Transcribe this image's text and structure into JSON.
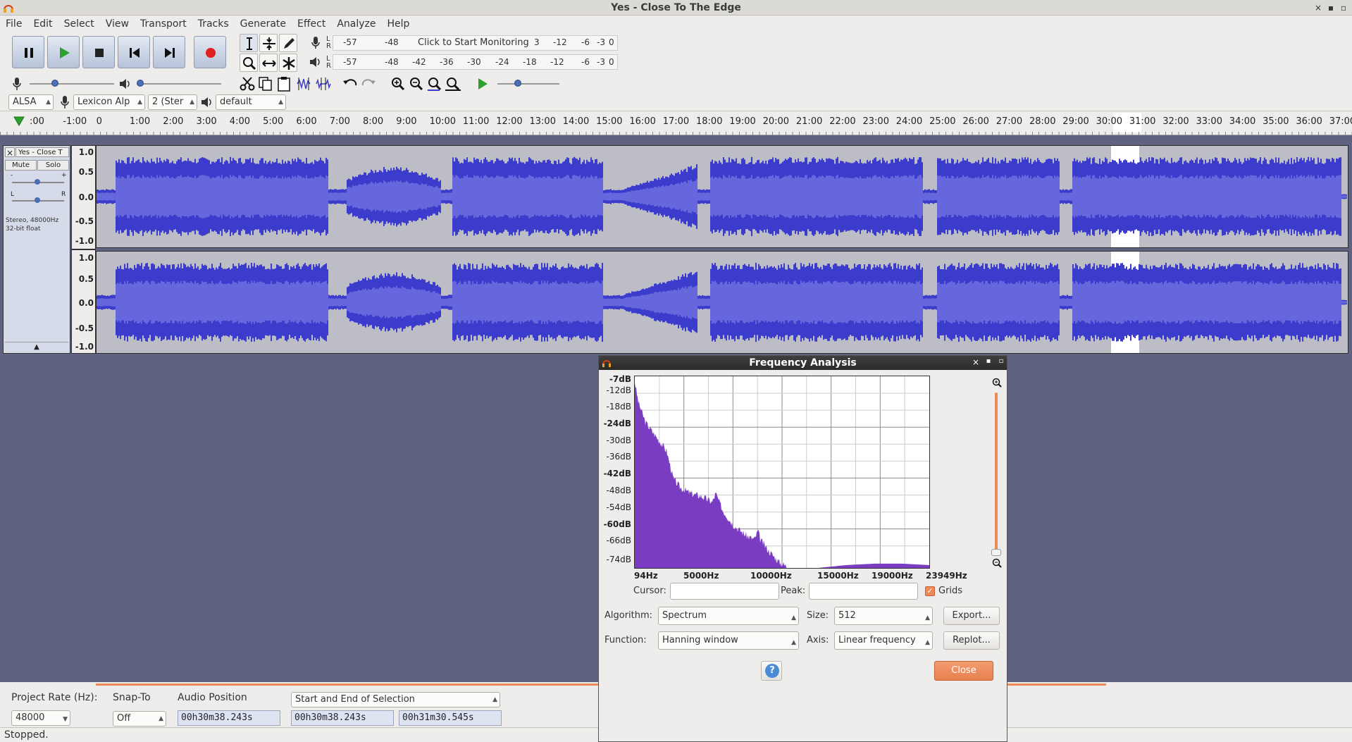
{
  "window": {
    "title": "Yes - Close To The Edge",
    "controls": [
      "×",
      "▪",
      "▫"
    ]
  },
  "menu": [
    "File",
    "Edit",
    "Select",
    "View",
    "Transport",
    "Tracks",
    "Generate",
    "Effect",
    "Analyze",
    "Help"
  ],
  "meters": {
    "record_ticks": [
      "-57",
      "-48",
      "3",
      "-12",
      "-6",
      "-3",
      "0"
    ],
    "record_prompt": "Click to Start Monitoring",
    "playback_ticks": [
      "-57",
      "-48",
      "-42",
      "-36",
      "-30",
      "-24",
      "-18",
      "-12",
      "-6",
      "-3",
      "0"
    ],
    "lr": [
      "L",
      "R"
    ]
  },
  "device": {
    "host": "ALSA",
    "input": "Lexicon Alp",
    "channels": "2 (Ster",
    "output": "default"
  },
  "ruler": {
    "labels": [
      ":00",
      "-1:00",
      "0",
      "1:00",
      "2:00",
      "3:00",
      "4:00",
      "5:00",
      "6:00",
      "7:00",
      "8:00",
      "9:00",
      "10:00",
      "11:00",
      "12:00",
      "13:00",
      "14:00",
      "15:00",
      "16:00",
      "17:00",
      "18:00",
      "19:00",
      "20:00",
      "21:00",
      "22:00",
      "23:00",
      "24:00",
      "25:00",
      "26:00",
      "27:00",
      "28:00",
      "29:00",
      "30:00",
      "31:00",
      "32:00",
      "33:00",
      "34:00",
      "35:00",
      "36:00",
      "37:00"
    ]
  },
  "track": {
    "name": "Yes - Close T",
    "mute": "Mute",
    "solo": "Solo",
    "gain_marks": [
      "-",
      "+"
    ],
    "pan_marks": [
      "L",
      "R"
    ],
    "info_line1": "Stereo, 48000Hz",
    "info_line2": "32-bit float",
    "scale": [
      "1.0",
      "0.5",
      "0.0",
      "-0.5",
      "-1.0"
    ],
    "selection_start_min": 30.64,
    "selection_end_min": 31.51
  },
  "dialog": {
    "title": "Frequency Analysis",
    "y_labels": [
      "-7dB",
      "-12dB",
      "-18dB",
      "-24dB",
      "-30dB",
      "-36dB",
      "-42dB",
      "-48dB",
      "-54dB",
      "-60dB",
      "-66dB",
      "-74dB"
    ],
    "x_labels": [
      "94Hz",
      "5000Hz",
      "10000Hz",
      "15000Hz",
      "19000Hz",
      "23949Hz"
    ],
    "cursor_label": "Cursor:",
    "cursor_value": "",
    "peak_label": "Peak:",
    "peak_value": "",
    "grids_label": "Grids",
    "grids_checked": true,
    "algorithm_label": "Algorithm:",
    "algorithm_value": "Spectrum",
    "size_label": "Size:",
    "size_value": "512",
    "export_label": "Export...",
    "function_label": "Function:",
    "function_value": "Hanning window",
    "axis_label": "Axis:",
    "axis_value": "Linear frequency",
    "replot_label": "Replot...",
    "help_label": "?",
    "close_label": "Close",
    "spectrum_color": "#7a3cc0"
  },
  "status": {
    "project_rate_label": "Project Rate (Hz):",
    "project_rate_value": "48000",
    "snap_label": "Snap-To",
    "snap_value": "Off",
    "audio_position_label": "Audio Position",
    "selection_mode": "Start and End of Selection",
    "audio_position": "00h30m38.243s",
    "selection_start": "00h30m38.243s",
    "selection_end": "00h31m30.545s",
    "message": "Stopped."
  },
  "colors": {
    "waveform": "#3c3ccc",
    "waveform_rms": "#6666dd",
    "selection": "#ffffff",
    "accent": "#ee8a5a"
  }
}
